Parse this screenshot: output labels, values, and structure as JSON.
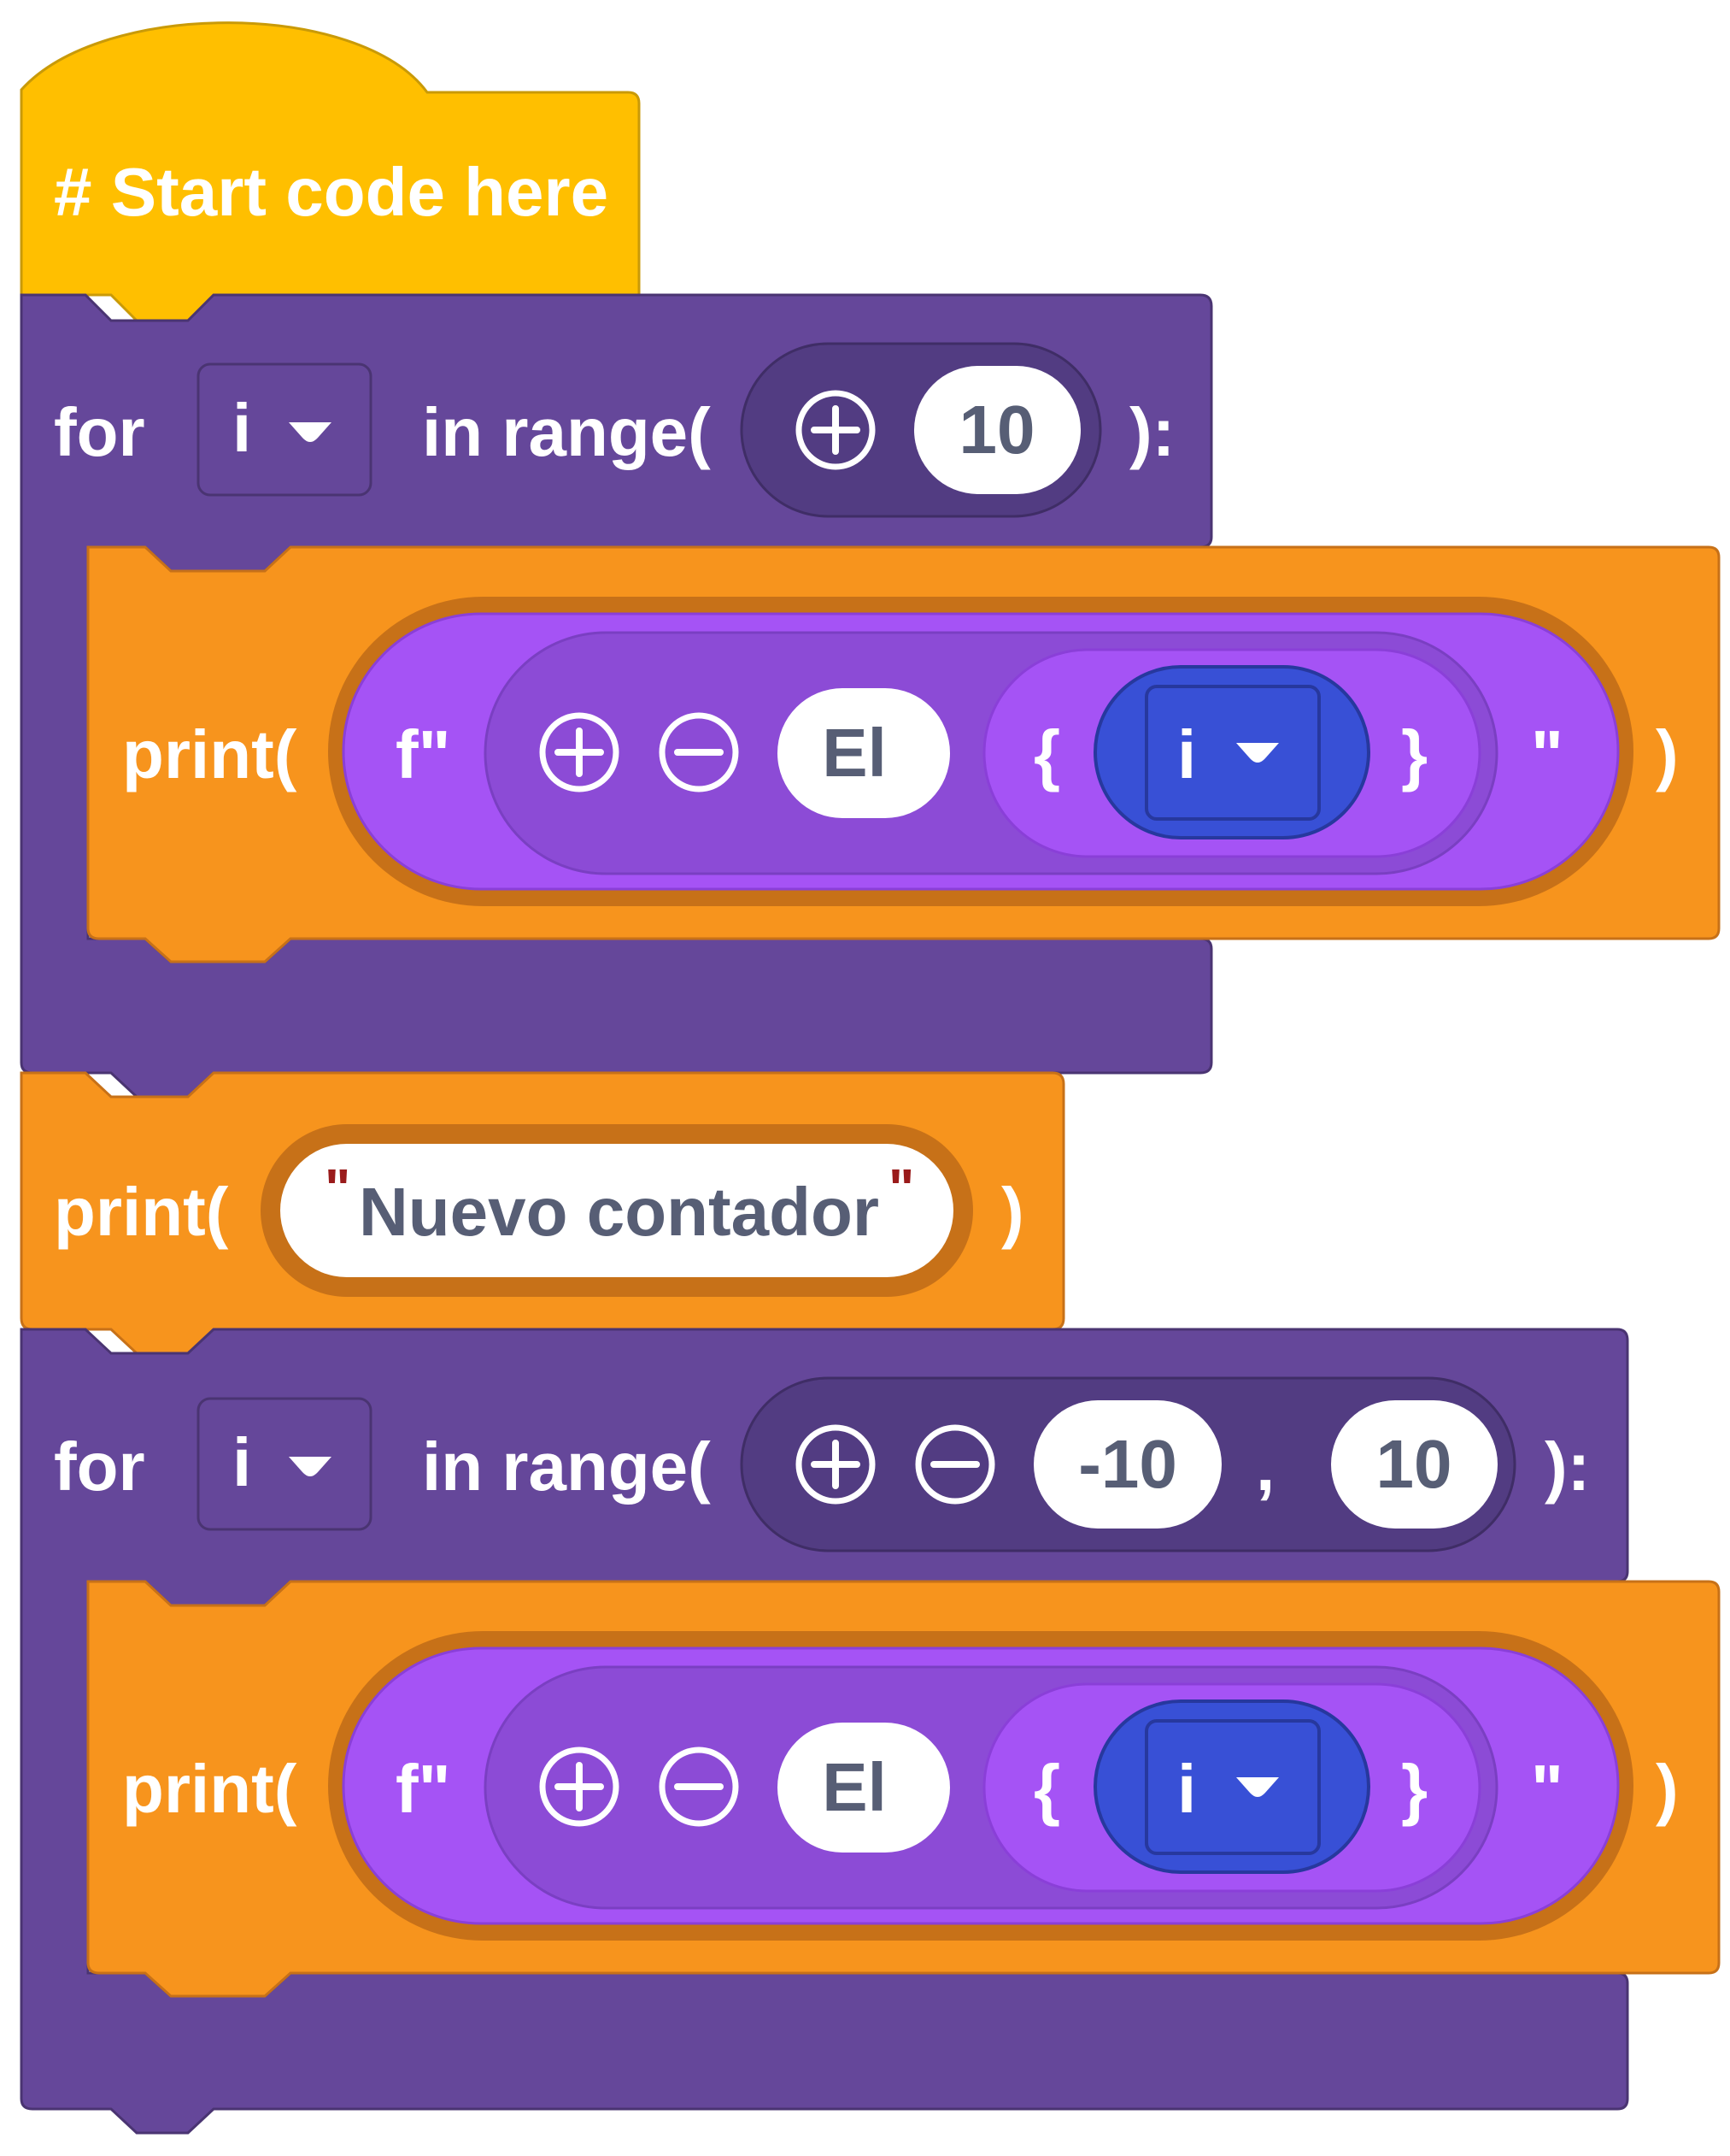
{
  "colors": {
    "hat": "#ffbf00",
    "loop": "#65479a",
    "loop_inner": "#523c82",
    "print": "#f7941d",
    "print_border": "#c77118",
    "fstring": "#a553f5",
    "fstring_inner": "#8c4bd6",
    "var_reporter": "#3850d6",
    "text_white": "#ffffff",
    "value_text": "#575e75",
    "quote_red": "#9a1b1b"
  },
  "icons": {
    "add": "plus-circle-icon",
    "remove": "minus-circle-icon",
    "dropdown": "chevron-down-icon"
  },
  "hat_block": {
    "label": "# Start code here"
  },
  "loop1": {
    "keyword": "for",
    "variable": "i",
    "range_label": "in range(",
    "args": [
      "10"
    ],
    "close": "):",
    "body": {
      "print_label": "print(",
      "fstring_prefix": "f\"",
      "text": "El",
      "brace_open": "{",
      "variable": "i",
      "brace_close": "}",
      "fstring_suffix": "\"",
      "close": ")"
    }
  },
  "print_middle": {
    "print_label": "print(",
    "quote_open": "\"",
    "text": "Nuevo contador",
    "quote_close": "\"",
    "close": ")"
  },
  "loop2": {
    "keyword": "for",
    "variable": "i",
    "range_label": "in range(",
    "args": [
      "-10",
      "10"
    ],
    "separator": ",",
    "close": "):",
    "body": {
      "print_label": "print(",
      "fstring_prefix": "f\"",
      "text": "El",
      "brace_open": "{",
      "variable": "i",
      "brace_close": "}",
      "fstring_suffix": "\"",
      "close": ")"
    }
  }
}
